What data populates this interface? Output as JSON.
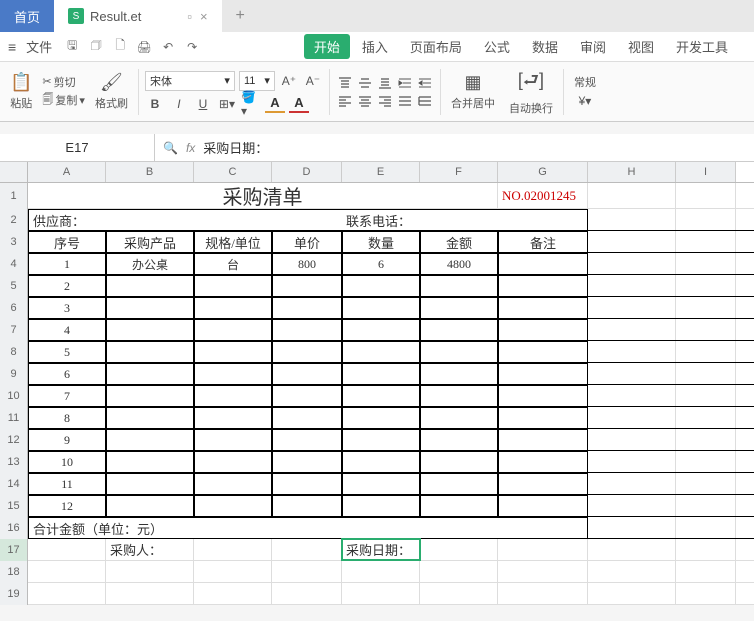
{
  "app_tabs": {
    "home": "首页",
    "doc": "Result.et",
    "plus": "+"
  },
  "file_label": "文件",
  "menu": [
    "开始",
    "插入",
    "页面布局",
    "公式",
    "数据",
    "审阅",
    "视图",
    "开发工具"
  ],
  "clip": {
    "paste": "粘贴",
    "cut": "剪切",
    "copy": "复制",
    "format_painter": "格式刷"
  },
  "font": {
    "name": "宋体",
    "size": "11",
    "b": "B",
    "i": "I",
    "u": "U"
  },
  "merge": "合并居中",
  "wrap": "自动换行",
  "gen": "常规",
  "name_box": "E17",
  "formula": "采购日期：",
  "cols": [
    "A",
    "B",
    "C",
    "D",
    "E",
    "F",
    "G",
    "H",
    "I"
  ],
  "title": "采购清单",
  "no": "NO.02001245",
  "row2": {
    "supplier": "供应商：",
    "phone": "联系电话："
  },
  "headers": [
    "序号",
    "采购产品",
    "规格/单位",
    "单价",
    "数量",
    "金额",
    "备注"
  ],
  "items": [
    {
      "seq": "1",
      "prod": "办公桌",
      "spec": "台",
      "price": "800",
      "qty": "6",
      "amt": "4800"
    },
    {
      "seq": "2"
    },
    {
      "seq": "3"
    },
    {
      "seq": "4"
    },
    {
      "seq": "5"
    },
    {
      "seq": "6"
    },
    {
      "seq": "7"
    },
    {
      "seq": "8"
    },
    {
      "seq": "9"
    },
    {
      "seq": "10"
    },
    {
      "seq": "11"
    },
    {
      "seq": "12"
    }
  ],
  "total": "合计金额（单位：元）",
  "buyer": "采购人：",
  "pdate": "采购日期：",
  "chart_data": {
    "type": "table",
    "title": "采购清单",
    "columns": [
      "序号",
      "采购产品",
      "规格/单位",
      "单价",
      "数量",
      "金额",
      "备注"
    ],
    "rows": [
      [
        "1",
        "办公桌",
        "台",
        800,
        6,
        4800,
        ""
      ]
    ]
  }
}
